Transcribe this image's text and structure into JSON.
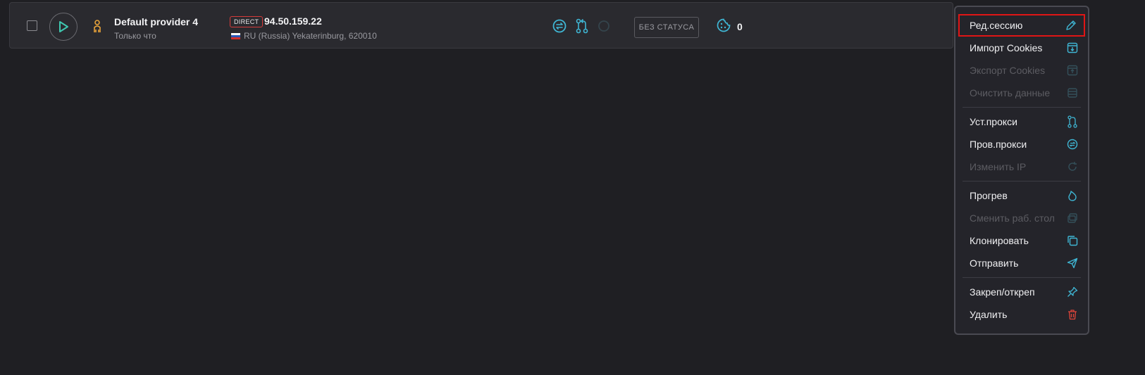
{
  "profile": {
    "name": "Default provider 4",
    "time": "Только что",
    "connection_type": "DIRECT",
    "ip": "94.50.159.22",
    "location": "RU (Russia) Yekaterinburg, 620010",
    "status": "БЕЗ СТАТУСА",
    "cookies_count": "0"
  },
  "menu": {
    "edit_session": "Ред.сессию",
    "import_cookies": "Импорт Cookies",
    "export_cookies": "Экспорт Cookies",
    "clear_data": "Очистить данные",
    "set_proxy": "Уст.прокси",
    "check_proxy": "Пров.прокси",
    "change_ip": "Изменить IP",
    "warmup": "Прогрев",
    "change_desktop": "Сменить раб. стол",
    "clone": "Клонировать",
    "send": "Отправить",
    "pin_unpin": "Закреп/откреп",
    "delete": "Удалить"
  },
  "colors": {
    "accent": "#3fb6d4",
    "danger": "#e0453a",
    "user_icon": "#e8a33a",
    "play": "#3fc8b0"
  }
}
